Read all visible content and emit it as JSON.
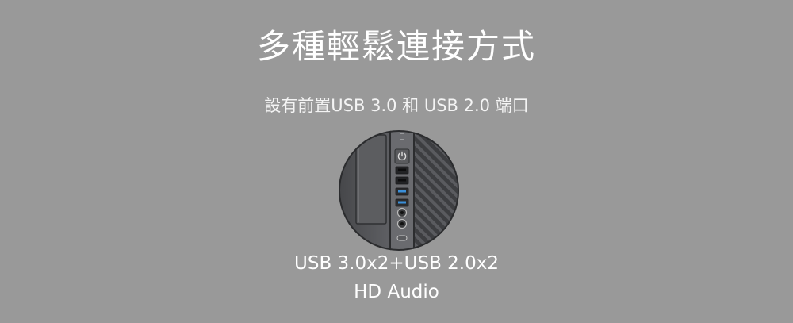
{
  "heading": {
    "title": "多種輕鬆連接方式",
    "subtitle": "設有前置USB 3.0 和 USB 2.0 端口"
  },
  "specs": {
    "ports_line": "USB 3.0x2+USB 2.0x2",
    "audio_line": "HD Audio"
  },
  "colors": {
    "background": "#999999",
    "text": "#ffffff",
    "panel_dark": "#3a3b3d",
    "usb3_blue": "#3b8fd9"
  },
  "icons": {
    "power": "power-icon",
    "usb": "usb-port-icon",
    "audio": "audio-jack-icon"
  }
}
